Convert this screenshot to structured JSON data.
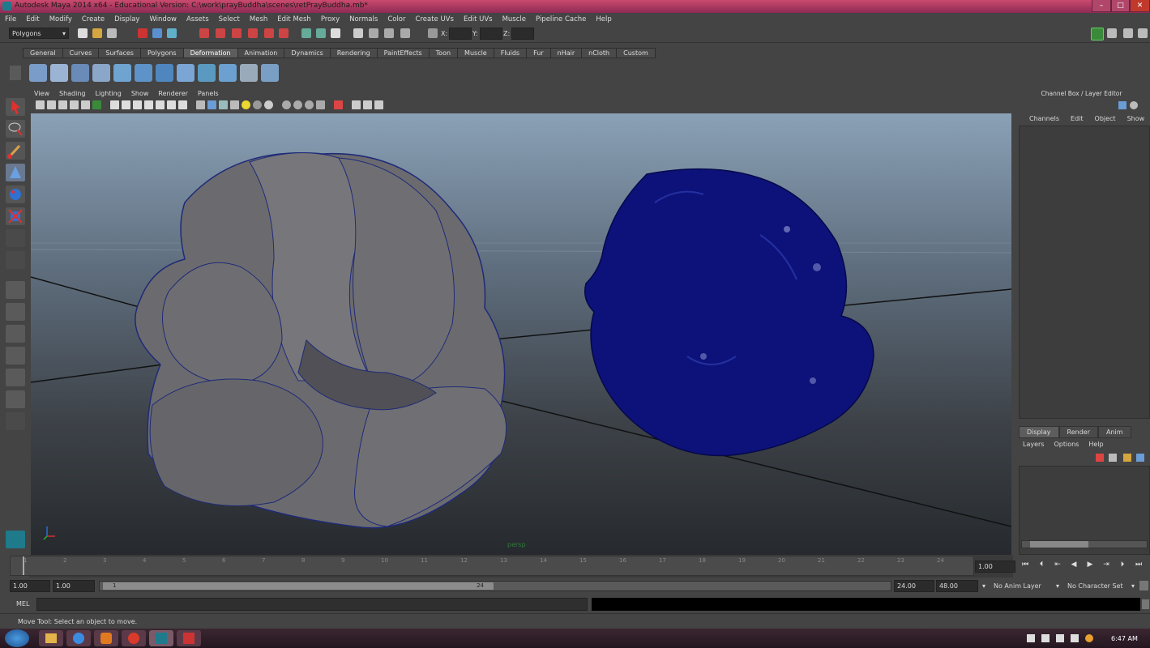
{
  "titlebar": {
    "title": "Autodesk Maya 2014 x64 - Educational Version: C:\\work\\prayBuddha\\scenes\\retPrayBuddha.mb*"
  },
  "menubar": [
    "File",
    "Edit",
    "Modify",
    "Create",
    "Display",
    "Window",
    "Assets",
    "Select",
    "Mesh",
    "Edit Mesh",
    "Proxy",
    "Normals",
    "Color",
    "Create UVs",
    "Edit UVs",
    "Muscle",
    "Pipeline Cache",
    "Help"
  ],
  "status": {
    "menuset": "Polygons",
    "x_label": "X:",
    "y_label": "Y:",
    "z_label": "Z:"
  },
  "shelf_tabs": [
    "General",
    "Curves",
    "Surfaces",
    "Polygons",
    "Deformation",
    "Animation",
    "Dynamics",
    "Rendering",
    "PaintEffects",
    "Toon",
    "Muscle",
    "Fluids",
    "Fur",
    "nHair",
    "nCloth",
    "Custom"
  ],
  "shelf_active": "Deformation",
  "viewport": {
    "menu": [
      "View",
      "Shading",
      "Lighting",
      "Show",
      "Renderer",
      "Panels"
    ],
    "camera": "persp"
  },
  "channelbox": {
    "title": "Channel Box / Layer Editor",
    "menu": [
      "Channels",
      "Edit",
      "Object",
      "Show"
    ],
    "tabs": [
      "Display",
      "Render",
      "Anim"
    ],
    "layer_menu": [
      "Layers",
      "Options",
      "Help"
    ]
  },
  "timeline": {
    "ticks": [
      "1",
      "2",
      "3",
      "4",
      "5",
      "6",
      "7",
      "8",
      "9",
      "10",
      "11",
      "12",
      "13",
      "14",
      "15",
      "16",
      "17",
      "18",
      "19",
      "20",
      "21",
      "22",
      "23",
      "24"
    ],
    "current": "1.00"
  },
  "range": {
    "start": "1.00",
    "start2": "1.00",
    "slider_start": "1",
    "slider_end": "24",
    "end": "24.00",
    "end2": "48.00",
    "anim_layer": "No Anim Layer",
    "char_set": "No Character Set"
  },
  "mel": {
    "label": "MEL"
  },
  "help": {
    "text": "Move Tool: Select an object to move."
  },
  "taskbar": {
    "time": "6:47 AM"
  }
}
